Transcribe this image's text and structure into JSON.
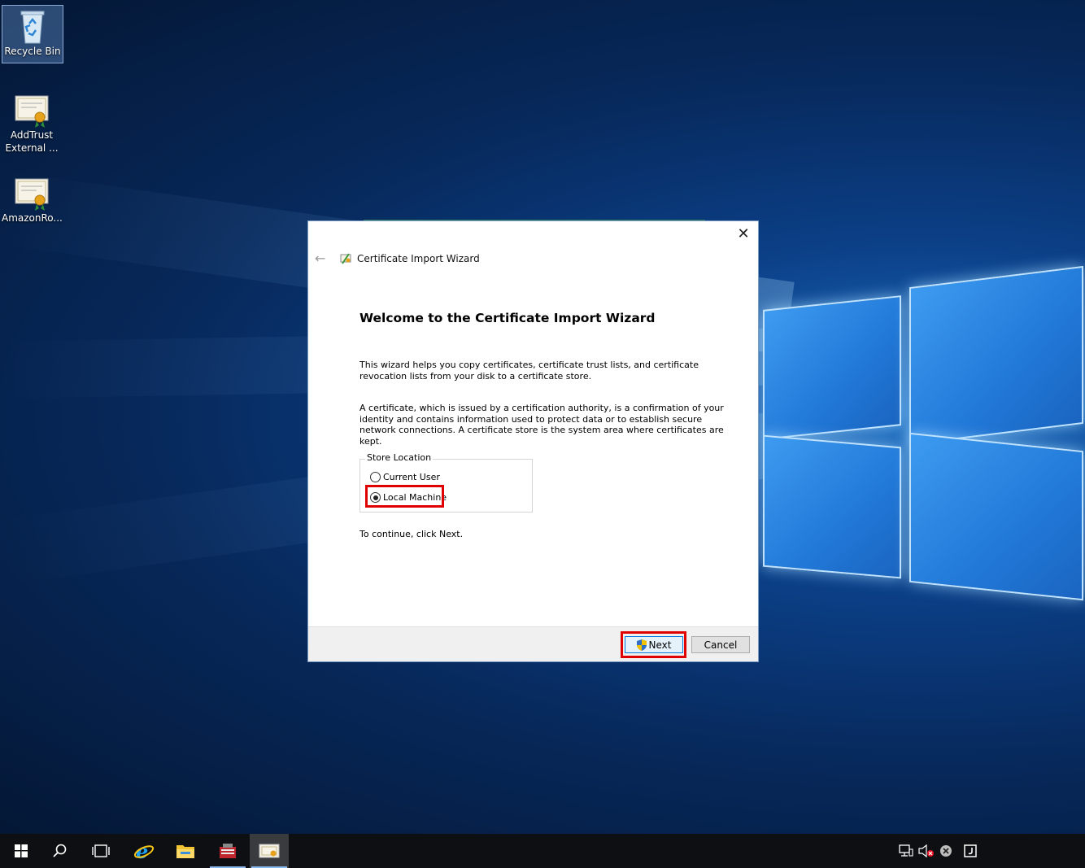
{
  "desktop": {
    "icons": [
      {
        "label": "Recycle Bin",
        "icon": "recycle-bin-icon"
      },
      {
        "label": "AddTrust\nExternal ...",
        "icon": "certificate-icon"
      },
      {
        "label": "AmazonRo...",
        "icon": "certificate-icon"
      }
    ]
  },
  "dialog": {
    "title": "Certificate Import Wizard",
    "heading": "Welcome to the Certificate Import Wizard",
    "paragraph1": "This wizard helps you copy certificates, certificate trust lists, and certificate revocation lists from your disk to a certificate store.",
    "paragraph2": "A certificate, which is issued by a certification authority, is a confirmation of your identity and contains information used to protect data or to establish secure network connections. A certificate store is the system area where certificates are kept.",
    "store_location": {
      "legend": "Store Location",
      "options": [
        {
          "label": "Current User",
          "checked": false
        },
        {
          "label": "Local Machine",
          "checked": true
        }
      ]
    },
    "continue_text": "To continue, click Next.",
    "buttons": {
      "next": "Next",
      "cancel": "Cancel"
    }
  },
  "taskbar": {
    "items": [
      "start-icon",
      "search-icon",
      "task-view-icon",
      "internet-explorer-icon",
      "file-explorer-icon",
      "server-manager-icon",
      "certificate-wizard-icon"
    ],
    "tray": [
      "network-icon",
      "volume-muted-icon",
      "close-circle-icon",
      "notification-icon"
    ]
  },
  "colors": {
    "highlight": "#e00000",
    "accent": "#0078d7"
  }
}
